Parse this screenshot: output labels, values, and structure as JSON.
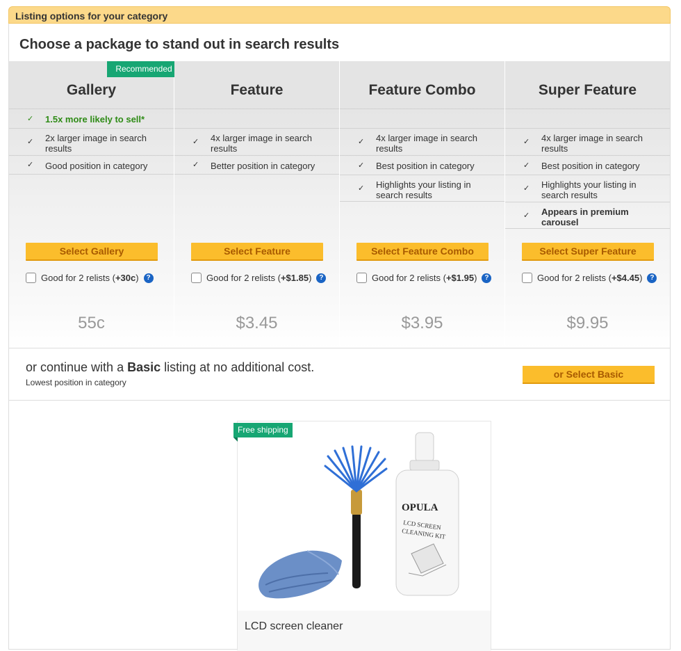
{
  "header": {
    "title": "Listing options for your category"
  },
  "choose_title": "Choose a package to stand out in search results",
  "packages": [
    {
      "name": "Gallery",
      "badge": "Recommended",
      "features": [
        "1.5x more likely to sell*",
        "2x larger image in search results",
        "Good position in category"
      ],
      "button": "Select Gallery",
      "relist_prefix": "Good for 2 relists (",
      "relist_amount": "+30c",
      "relist_suffix": ")",
      "price": "55c"
    },
    {
      "name": "Feature",
      "features": [
        "4x larger image in search results",
        "Better position in category"
      ],
      "button": "Select Feature",
      "relist_prefix": "Good for 2 relists (",
      "relist_amount": "+$1.85",
      "relist_suffix": ")",
      "price": "$3.45"
    },
    {
      "name": "Feature Combo",
      "features": [
        "4x larger image in search results",
        "Best position in category",
        "Highlights your listing in search results"
      ],
      "button": "Select Feature Combo",
      "relist_prefix": "Good for 2 relists (",
      "relist_amount": "+$1.95",
      "relist_suffix": ")",
      "price": "$3.95"
    },
    {
      "name": "Super Feature",
      "features": [
        "4x larger image in search results",
        "Best position in category",
        "Highlights your listing in search results",
        "Appears in premium carousel"
      ],
      "button": "Select Super Feature",
      "relist_prefix": "Good for 2 relists (",
      "relist_amount": "+$4.45",
      "relist_suffix": ")",
      "price": "$9.95"
    }
  ],
  "help_glyph": "?",
  "check_glyph": "✓",
  "basic": {
    "prefix": "or continue with a ",
    "bold": "Basic",
    "suffix": " listing at no additional cost.",
    "subtext": "Lowest position in category",
    "button": "or Select Basic"
  },
  "preview": {
    "badge": "Free shipping",
    "title": "LCD screen cleaner",
    "bottle_brand": "OPULA",
    "bottle_label_line1": "LCD SCREEN",
    "bottle_label_line2": "CLEANING KIT"
  },
  "colors": {
    "accent_green": "#17a673",
    "button_yellow": "#fbbd2c",
    "button_text": "#a85a00",
    "header_bg": "#fcd98a",
    "help_blue": "#1a64c4"
  }
}
